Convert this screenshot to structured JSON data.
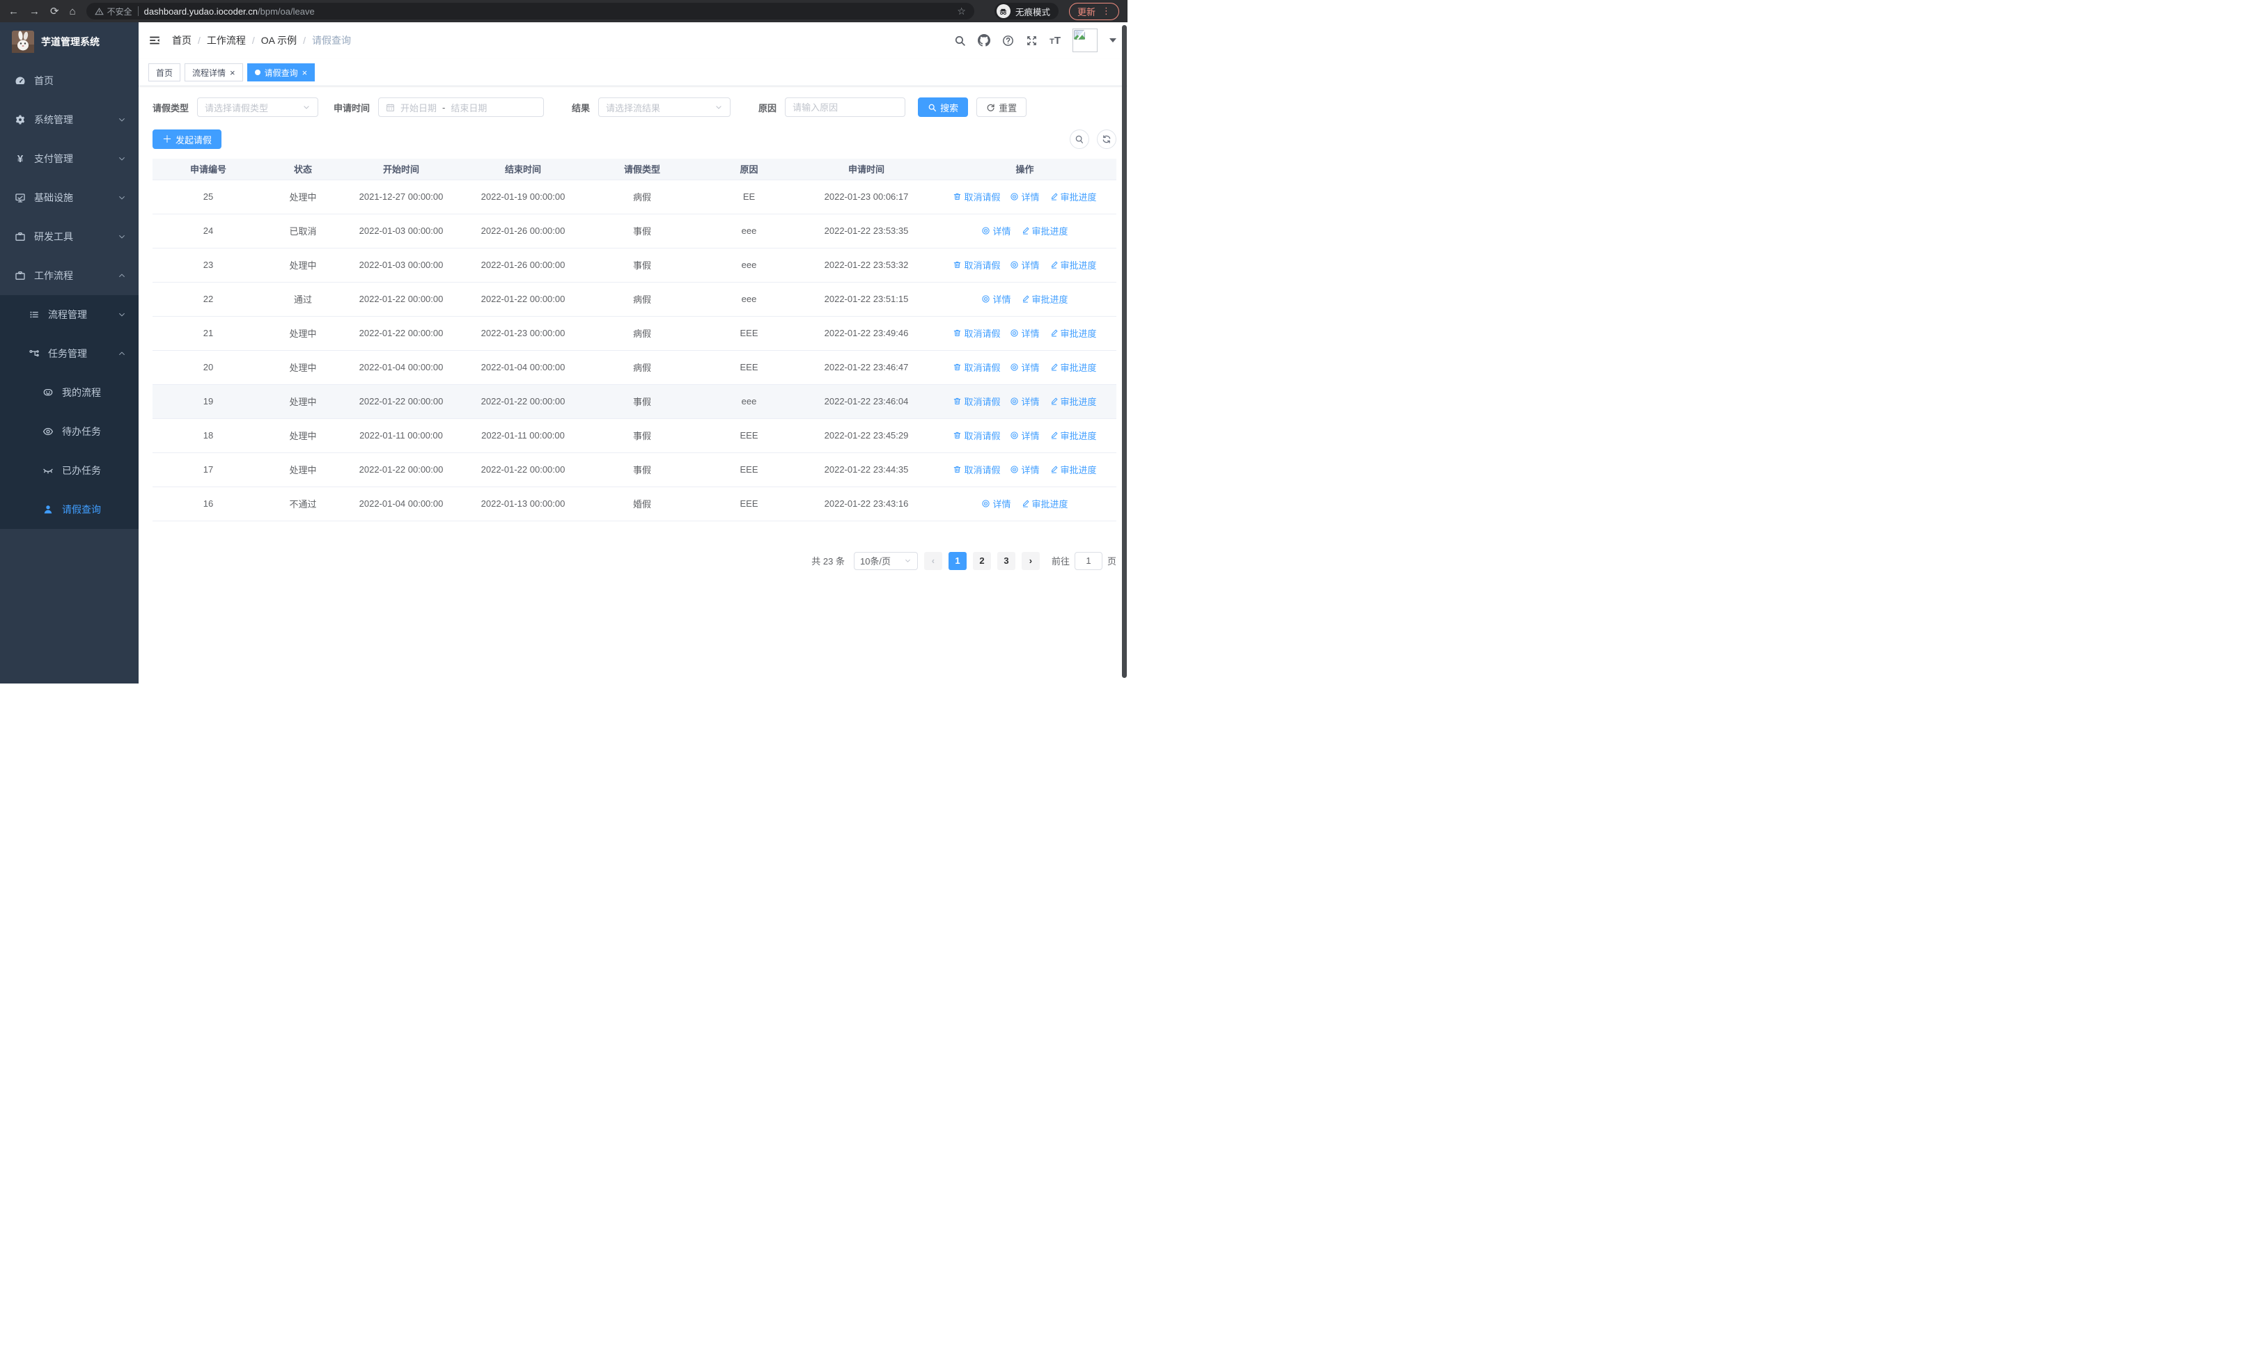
{
  "browser": {
    "security_label": "不安全",
    "url_host": "dashboard.yudao.iocoder.cn",
    "url_path": "/bpm/oa/leave",
    "incognito_label": "无痕模式",
    "update_label": "更新"
  },
  "sidebar": {
    "title": "芋道管理系统",
    "items": [
      {
        "key": "home",
        "label": "首页",
        "icon": "dashboard-icon",
        "level": 1,
        "sub": false,
        "arrow": null,
        "active": false
      },
      {
        "key": "system",
        "label": "系统管理",
        "icon": "gear-icon",
        "level": 1,
        "sub": false,
        "arrow": "down",
        "active": false
      },
      {
        "key": "payment",
        "label": "支付管理",
        "icon": "yen-icon",
        "level": 1,
        "sub": false,
        "arrow": "down",
        "active": false
      },
      {
        "key": "infra",
        "label": "基础设施",
        "icon": "monitor-icon",
        "level": 1,
        "sub": false,
        "arrow": "down",
        "active": false
      },
      {
        "key": "devtools",
        "label": "研发工具",
        "icon": "toolbox-icon",
        "level": 1,
        "sub": false,
        "arrow": "down",
        "active": false
      },
      {
        "key": "workflow",
        "label": "工作流程",
        "icon": "toolbox-icon",
        "level": 1,
        "sub": false,
        "arrow": "up",
        "active": false
      },
      {
        "key": "process-mgmt",
        "label": "流程管理",
        "icon": "list-icon",
        "level": 2,
        "sub": true,
        "arrow": "down",
        "active": false
      },
      {
        "key": "task-mgmt",
        "label": "任务管理",
        "icon": "flow-icon",
        "level": 2,
        "sub": true,
        "arrow": "up",
        "active": false
      },
      {
        "key": "my-process",
        "label": "我的流程",
        "icon": "chat-icon",
        "level": 3,
        "sub": true,
        "arrow": null,
        "active": false
      },
      {
        "key": "todo-tasks",
        "label": "待办任务",
        "icon": "eye-icon",
        "level": 3,
        "sub": true,
        "arrow": null,
        "active": false
      },
      {
        "key": "done-tasks",
        "label": "已办任务",
        "icon": "eye-closed-icon",
        "level": 3,
        "sub": true,
        "arrow": null,
        "active": false
      },
      {
        "key": "leave-query",
        "label": "请假查询",
        "icon": "user-icon",
        "level": 3,
        "sub": true,
        "arrow": null,
        "active": true
      }
    ]
  },
  "breadcrumb": [
    {
      "label": "首页",
      "current": false
    },
    {
      "label": "工作流程",
      "current": false
    },
    {
      "label": "OA 示例",
      "current": false
    },
    {
      "label": "请假查询",
      "current": true
    }
  ],
  "tabs": [
    {
      "label": "首页",
      "closable": false,
      "active": false
    },
    {
      "label": "流程详情",
      "closable": true,
      "active": false
    },
    {
      "label": "请假查询",
      "closable": true,
      "active": true
    }
  ],
  "filters": {
    "leave_type_label": "请假类型",
    "leave_type_placeholder": "请选择请假类型",
    "apply_time_label": "申请时间",
    "start_placeholder": "开始日期",
    "range_separator": "-",
    "end_placeholder": "结束日期",
    "result_label": "结果",
    "result_placeholder": "请选择流结果",
    "reason_label": "原因",
    "reason_placeholder": "请输入原因",
    "search_label": "搜索",
    "reset_label": "重置"
  },
  "toolbar": {
    "create_label": "发起请假"
  },
  "table": {
    "columns": [
      "申请编号",
      "状态",
      "开始时间",
      "结束时间",
      "请假类型",
      "原因",
      "申请时间",
      "操作"
    ],
    "action_defs": {
      "cancel": {
        "label": "取消请假",
        "icon": "trash-icon"
      },
      "detail": {
        "label": "详情",
        "icon": "view-icon"
      },
      "progress": {
        "label": "审批进度",
        "icon": "edit-icon"
      }
    },
    "rows": [
      {
        "id": "25",
        "status": "处理中",
        "start": "2021-12-27 00:00:00",
        "end": "2022-01-19 00:00:00",
        "type": "病假",
        "reason": "EE",
        "applied": "2022-01-23 00:06:17",
        "actions": [
          "cancel",
          "detail",
          "progress"
        ],
        "highlighted": false
      },
      {
        "id": "24",
        "status": "已取消",
        "start": "2022-01-03 00:00:00",
        "end": "2022-01-26 00:00:00",
        "type": "事假",
        "reason": "eee",
        "applied": "2022-01-22 23:53:35",
        "actions": [
          "detail",
          "progress"
        ],
        "highlighted": false
      },
      {
        "id": "23",
        "status": "处理中",
        "start": "2022-01-03 00:00:00",
        "end": "2022-01-26 00:00:00",
        "type": "事假",
        "reason": "eee",
        "applied": "2022-01-22 23:53:32",
        "actions": [
          "cancel",
          "detail",
          "progress"
        ],
        "highlighted": false
      },
      {
        "id": "22",
        "status": "通过",
        "start": "2022-01-22 00:00:00",
        "end": "2022-01-22 00:00:00",
        "type": "病假",
        "reason": "eee",
        "applied": "2022-01-22 23:51:15",
        "actions": [
          "detail",
          "progress"
        ],
        "highlighted": false
      },
      {
        "id": "21",
        "status": "处理中",
        "start": "2022-01-22 00:00:00",
        "end": "2022-01-23 00:00:00",
        "type": "病假",
        "reason": "EEE",
        "applied": "2022-01-22 23:49:46",
        "actions": [
          "cancel",
          "detail",
          "progress"
        ],
        "highlighted": false
      },
      {
        "id": "20",
        "status": "处理中",
        "start": "2022-01-04 00:00:00",
        "end": "2022-01-04 00:00:00",
        "type": "病假",
        "reason": "EEE",
        "applied": "2022-01-22 23:46:47",
        "actions": [
          "cancel",
          "detail",
          "progress"
        ],
        "highlighted": false
      },
      {
        "id": "19",
        "status": "处理中",
        "start": "2022-01-22 00:00:00",
        "end": "2022-01-22 00:00:00",
        "type": "事假",
        "reason": "eee",
        "applied": "2022-01-22 23:46:04",
        "actions": [
          "cancel",
          "detail",
          "progress"
        ],
        "highlighted": true
      },
      {
        "id": "18",
        "status": "处理中",
        "start": "2022-01-11 00:00:00",
        "end": "2022-01-11 00:00:00",
        "type": "事假",
        "reason": "EEE",
        "applied": "2022-01-22 23:45:29",
        "actions": [
          "cancel",
          "detail",
          "progress"
        ],
        "highlighted": false
      },
      {
        "id": "17",
        "status": "处理中",
        "start": "2022-01-22 00:00:00",
        "end": "2022-01-22 00:00:00",
        "type": "事假",
        "reason": "EEE",
        "applied": "2022-01-22 23:44:35",
        "actions": [
          "cancel",
          "detail",
          "progress"
        ],
        "highlighted": false
      },
      {
        "id": "16",
        "status": "不通过",
        "start": "2022-01-04 00:00:00",
        "end": "2022-01-13 00:00:00",
        "type": "婚假",
        "reason": "EEE",
        "applied": "2022-01-22 23:43:16",
        "actions": [
          "detail",
          "progress"
        ],
        "highlighted": false
      }
    ]
  },
  "pagination": {
    "total_label": "共 23 条",
    "page_size_label": "10条/页",
    "prev_label": "‹",
    "next_label": "›",
    "pages": [
      {
        "label": "1",
        "active": true
      },
      {
        "label": "2",
        "active": false
      },
      {
        "label": "3",
        "active": false
      }
    ],
    "goto_label": "前往",
    "goto_value": "1",
    "goto_unit": "页"
  },
  "colors": {
    "accent": "#409eff",
    "sidebar_bg": "#2d3a4b",
    "sidebar_sub_bg": "#1f2d3d",
    "update_accent": "#ef8c7f"
  }
}
